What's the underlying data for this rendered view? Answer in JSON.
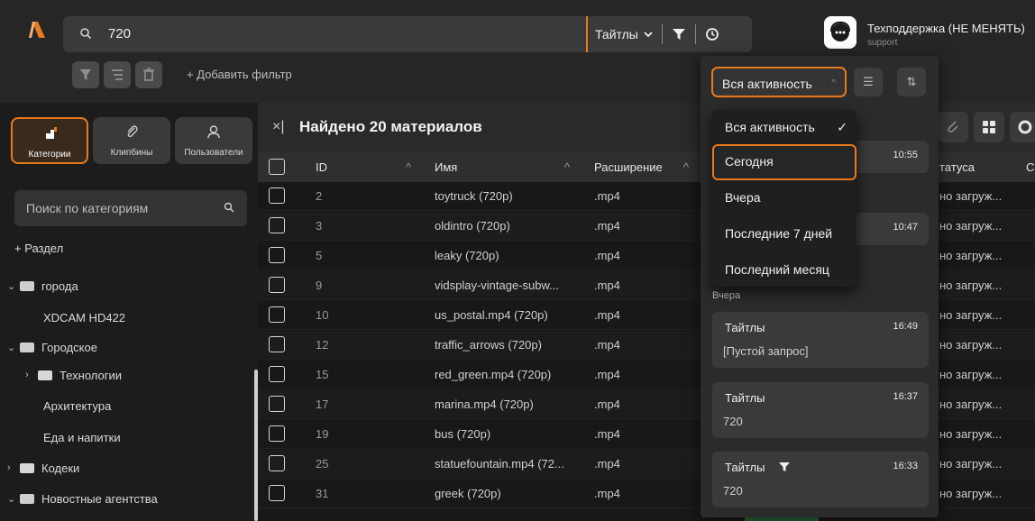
{
  "topbar": {
    "search_value": "720",
    "scope_label": "Тайтлы",
    "support_name": "Техподдержка (НЕ МЕНЯТЬ)",
    "support_role": "support"
  },
  "filterbar": {
    "add_filter": "+ Добавить фильтр"
  },
  "left": {
    "tabs": [
      {
        "label": "Категории"
      },
      {
        "label": "Клипбины"
      },
      {
        "label": "Пользователи"
      }
    ],
    "search_placeholder": "Поиск по категориям",
    "add_section": "+ Раздел",
    "tree": [
      {
        "label": "города"
      },
      {
        "label": "XDCAM HD422"
      },
      {
        "label": "Городское"
      },
      {
        "label": "Технологии"
      },
      {
        "label": "Архитектура"
      },
      {
        "label": "Еда и напитки"
      },
      {
        "label": "Кодеки"
      },
      {
        "label": "Новостные агентства"
      }
    ]
  },
  "main": {
    "close": "×|",
    "title": "Найдено 20 материалов",
    "columns": {
      "id": "ID",
      "name": "Имя",
      "ext": "Расширение",
      "status": "татуса",
      "last": "С"
    },
    "rows": [
      {
        "id": "2",
        "name": "toytruck (720p)",
        "ext": ".mp4",
        "status": "но загруж..."
      },
      {
        "id": "3",
        "name": "oldintro (720p)",
        "ext": ".mp4",
        "status": "но загруж..."
      },
      {
        "id": "5",
        "name": "leaky (720p)",
        "ext": ".mp4",
        "status": "но загруж..."
      },
      {
        "id": "9",
        "name": "vidsplay-vintage-subw...",
        "ext": ".mp4",
        "status": "но загруж..."
      },
      {
        "id": "10",
        "name": "us_postal.mp4 (720p)",
        "ext": ".mp4",
        "status": "но загруж..."
      },
      {
        "id": "12",
        "name": "traffic_arrows (720p)",
        "ext": ".mp4",
        "status": "но загруж..."
      },
      {
        "id": "15",
        "name": "red_green.mp4 (720p)",
        "ext": ".mp4",
        "status": "но загруж..."
      },
      {
        "id": "17",
        "name": "marina.mp4 (720p)",
        "ext": ".mp4",
        "status": "но загруж..."
      },
      {
        "id": "19",
        "name": "bus (720p)",
        "ext": ".mp4",
        "status": "но загруж..."
      },
      {
        "id": "25",
        "name": "statuefountain.mp4 (72...",
        "ext": ".mp4",
        "status": "но загруж..."
      },
      {
        "id": "31",
        "name": "greek (720p)",
        "ext": ".mp4",
        "status": "но загруж..."
      }
    ]
  },
  "activity": {
    "selected": "Вся активность",
    "menu": [
      {
        "label": "Вся активность",
        "check": "✓"
      },
      {
        "label": "Сегодня"
      },
      {
        "label": "Вчера"
      },
      {
        "label": "Последние 7 дней"
      },
      {
        "label": "Последний месяц"
      }
    ],
    "cards_today": [
      {
        "time": "10:55"
      },
      {
        "time": "10:47"
      }
    ],
    "yesterday_label": "Вчера",
    "cards_yesterday": [
      {
        "title": "Тайтлы",
        "time": "16:49",
        "query": "[Пустой запрос]"
      },
      {
        "title": "Тайтлы",
        "time": "16:37",
        "query": "720"
      },
      {
        "title": "Тайтлы",
        "time": "16:33",
        "query": "720"
      }
    ]
  },
  "colors": {
    "accent": "#e87a1e",
    "bg": "#1f1f1f",
    "panel": "#2b2b2b"
  }
}
